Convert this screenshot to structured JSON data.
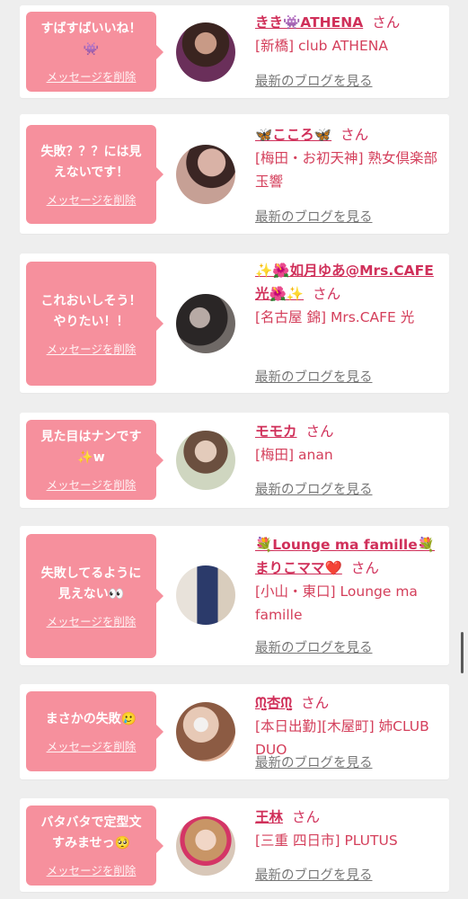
{
  "cards": [
    {
      "message_lines": [
        "すばすばいいね！",
        "👾"
      ],
      "delete_label": "メッセージを削除",
      "name": "きき👾ATHENA",
      "san": "さん",
      "shop": "[新橋] club ATHENA",
      "blog_label": "最新のブログを見る"
    },
    {
      "message_lines": [
        "失敗？？？には見",
        "えないです！"
      ],
      "delete_label": "メッセージを削除",
      "name": "🦋こころ🦋",
      "san": "さん",
      "shop": "[梅田・お初天神] 熟女倶楽部 玉響",
      "blog_label": "最新のブログを見る"
    },
    {
      "message_lines": [
        "これおいしそう！",
        "やりたい！！"
      ],
      "delete_label": "メッセージを削除",
      "name": "✨🌺如月ゆあ@Mrs.CAFE光🌺✨",
      "san": "さん",
      "shop": "[名古屋 錦] Mrs.CAFE 光",
      "blog_label": "最新のブログを見る"
    },
    {
      "message_lines": [
        "見た目はナンです",
        "✨w"
      ],
      "delete_label": "メッセージを削除",
      "name": "モモカ",
      "san": "さん",
      "shop": "[梅田] anan",
      "blog_label": "最新のブログを見る"
    },
    {
      "message_lines": [
        "失敗してるように",
        "見えない👀"
      ],
      "delete_label": "メッセージを削除",
      "name": "💐Lounge ma famille💐まりこママ❤️",
      "san": "さん",
      "shop": "[小山・東口] Lounge ma famille",
      "blog_label": "最新のブログを見る"
    },
    {
      "message_lines": [
        "まさかの失敗🥲"
      ],
      "delete_label": "メッセージを削除",
      "name": "ᙏ̤̫杏ᙏ̤̫",
      "san": "さん",
      "shop": "[本日出勤][木屋町] 姉CLUB DUO",
      "blog_label": "最新のブログを見る"
    },
    {
      "message_lines": [
        "バタバタで定型文",
        "すみませっ🥺"
      ],
      "delete_label": "メッセージを削除",
      "name": "王林",
      "san": "さん",
      "shop": "[三重 四日市] PLUTUS",
      "blog_label": "最新のブログを見る"
    }
  ],
  "colors": {
    "bubble": "#f6909d",
    "name": "#d0305a",
    "shop": "#d43f5b",
    "blog_link": "#777777",
    "background": "#eeeeee"
  }
}
